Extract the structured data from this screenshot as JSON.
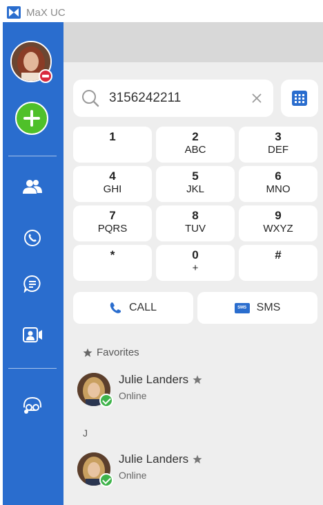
{
  "app": {
    "title": "MaX UC"
  },
  "dialer": {
    "input_value": "3156242211",
    "keys": [
      {
        "digit": "1",
        "letters": ""
      },
      {
        "digit": "2",
        "letters": "ABC"
      },
      {
        "digit": "3",
        "letters": "DEF"
      },
      {
        "digit": "4",
        "letters": "GHI"
      },
      {
        "digit": "5",
        "letters": "JKL"
      },
      {
        "digit": "6",
        "letters": "MNO"
      },
      {
        "digit": "7",
        "letters": "PQRS"
      },
      {
        "digit": "8",
        "letters": "TUV"
      },
      {
        "digit": "9",
        "letters": "WXYZ"
      },
      {
        "digit": "*",
        "letters": ""
      },
      {
        "digit": "0",
        "letters": "+"
      },
      {
        "digit": "#",
        "letters": ""
      }
    ],
    "call_label": "CALL",
    "sms_label": "SMS",
    "sms_icon_text": "SMS"
  },
  "contacts": {
    "favorites_title": "Favorites",
    "favorites": [
      {
        "name": "Julie Landers",
        "status": "Online"
      }
    ],
    "groups": [
      {
        "letter": "J",
        "items": [
          {
            "name": "Julie Landers",
            "status": "Online"
          }
        ]
      }
    ]
  },
  "colors": {
    "sidebar": "#2a6dce",
    "add_button": "#4fc02a",
    "status_dnd": "#d92a3e",
    "status_online": "#3eb34a",
    "accent": "#2a6dce"
  },
  "icons": {
    "sidebar": [
      "contacts-icon",
      "phone-icon",
      "chat-icon",
      "meeting-icon",
      "voicemail-icon"
    ]
  }
}
